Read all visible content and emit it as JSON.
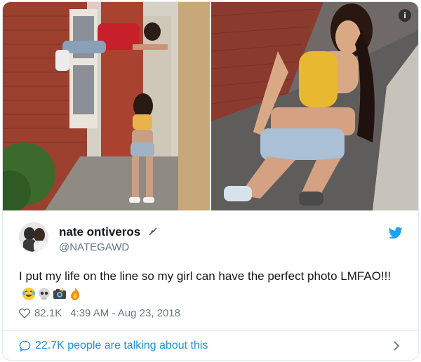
{
  "tweet": {
    "display_name": "nate ontiveros",
    "handle": "@NATEGAWD",
    "text": "I put my life on the line so my girl can have the perfect photo LMFAO!!!",
    "emojis": [
      "laughing-tears",
      "skull",
      "camera-flash",
      "fire"
    ],
    "likes": "82.1K",
    "timestamp": "4:39 AM - Aug 23, 2018",
    "conversation": "22.7K people are talking about this"
  },
  "icons": {
    "info": "info-icon",
    "bird": "twitter-bird-icon",
    "heart": "heart-icon",
    "chat": "chat-bubble-icon",
    "chevron": "chevron-right-icon",
    "verified": "feather-icon"
  },
  "colors": {
    "accent": "#1da1f2",
    "link": "#1b95e0",
    "muted": "#657786",
    "text": "#14171a"
  }
}
